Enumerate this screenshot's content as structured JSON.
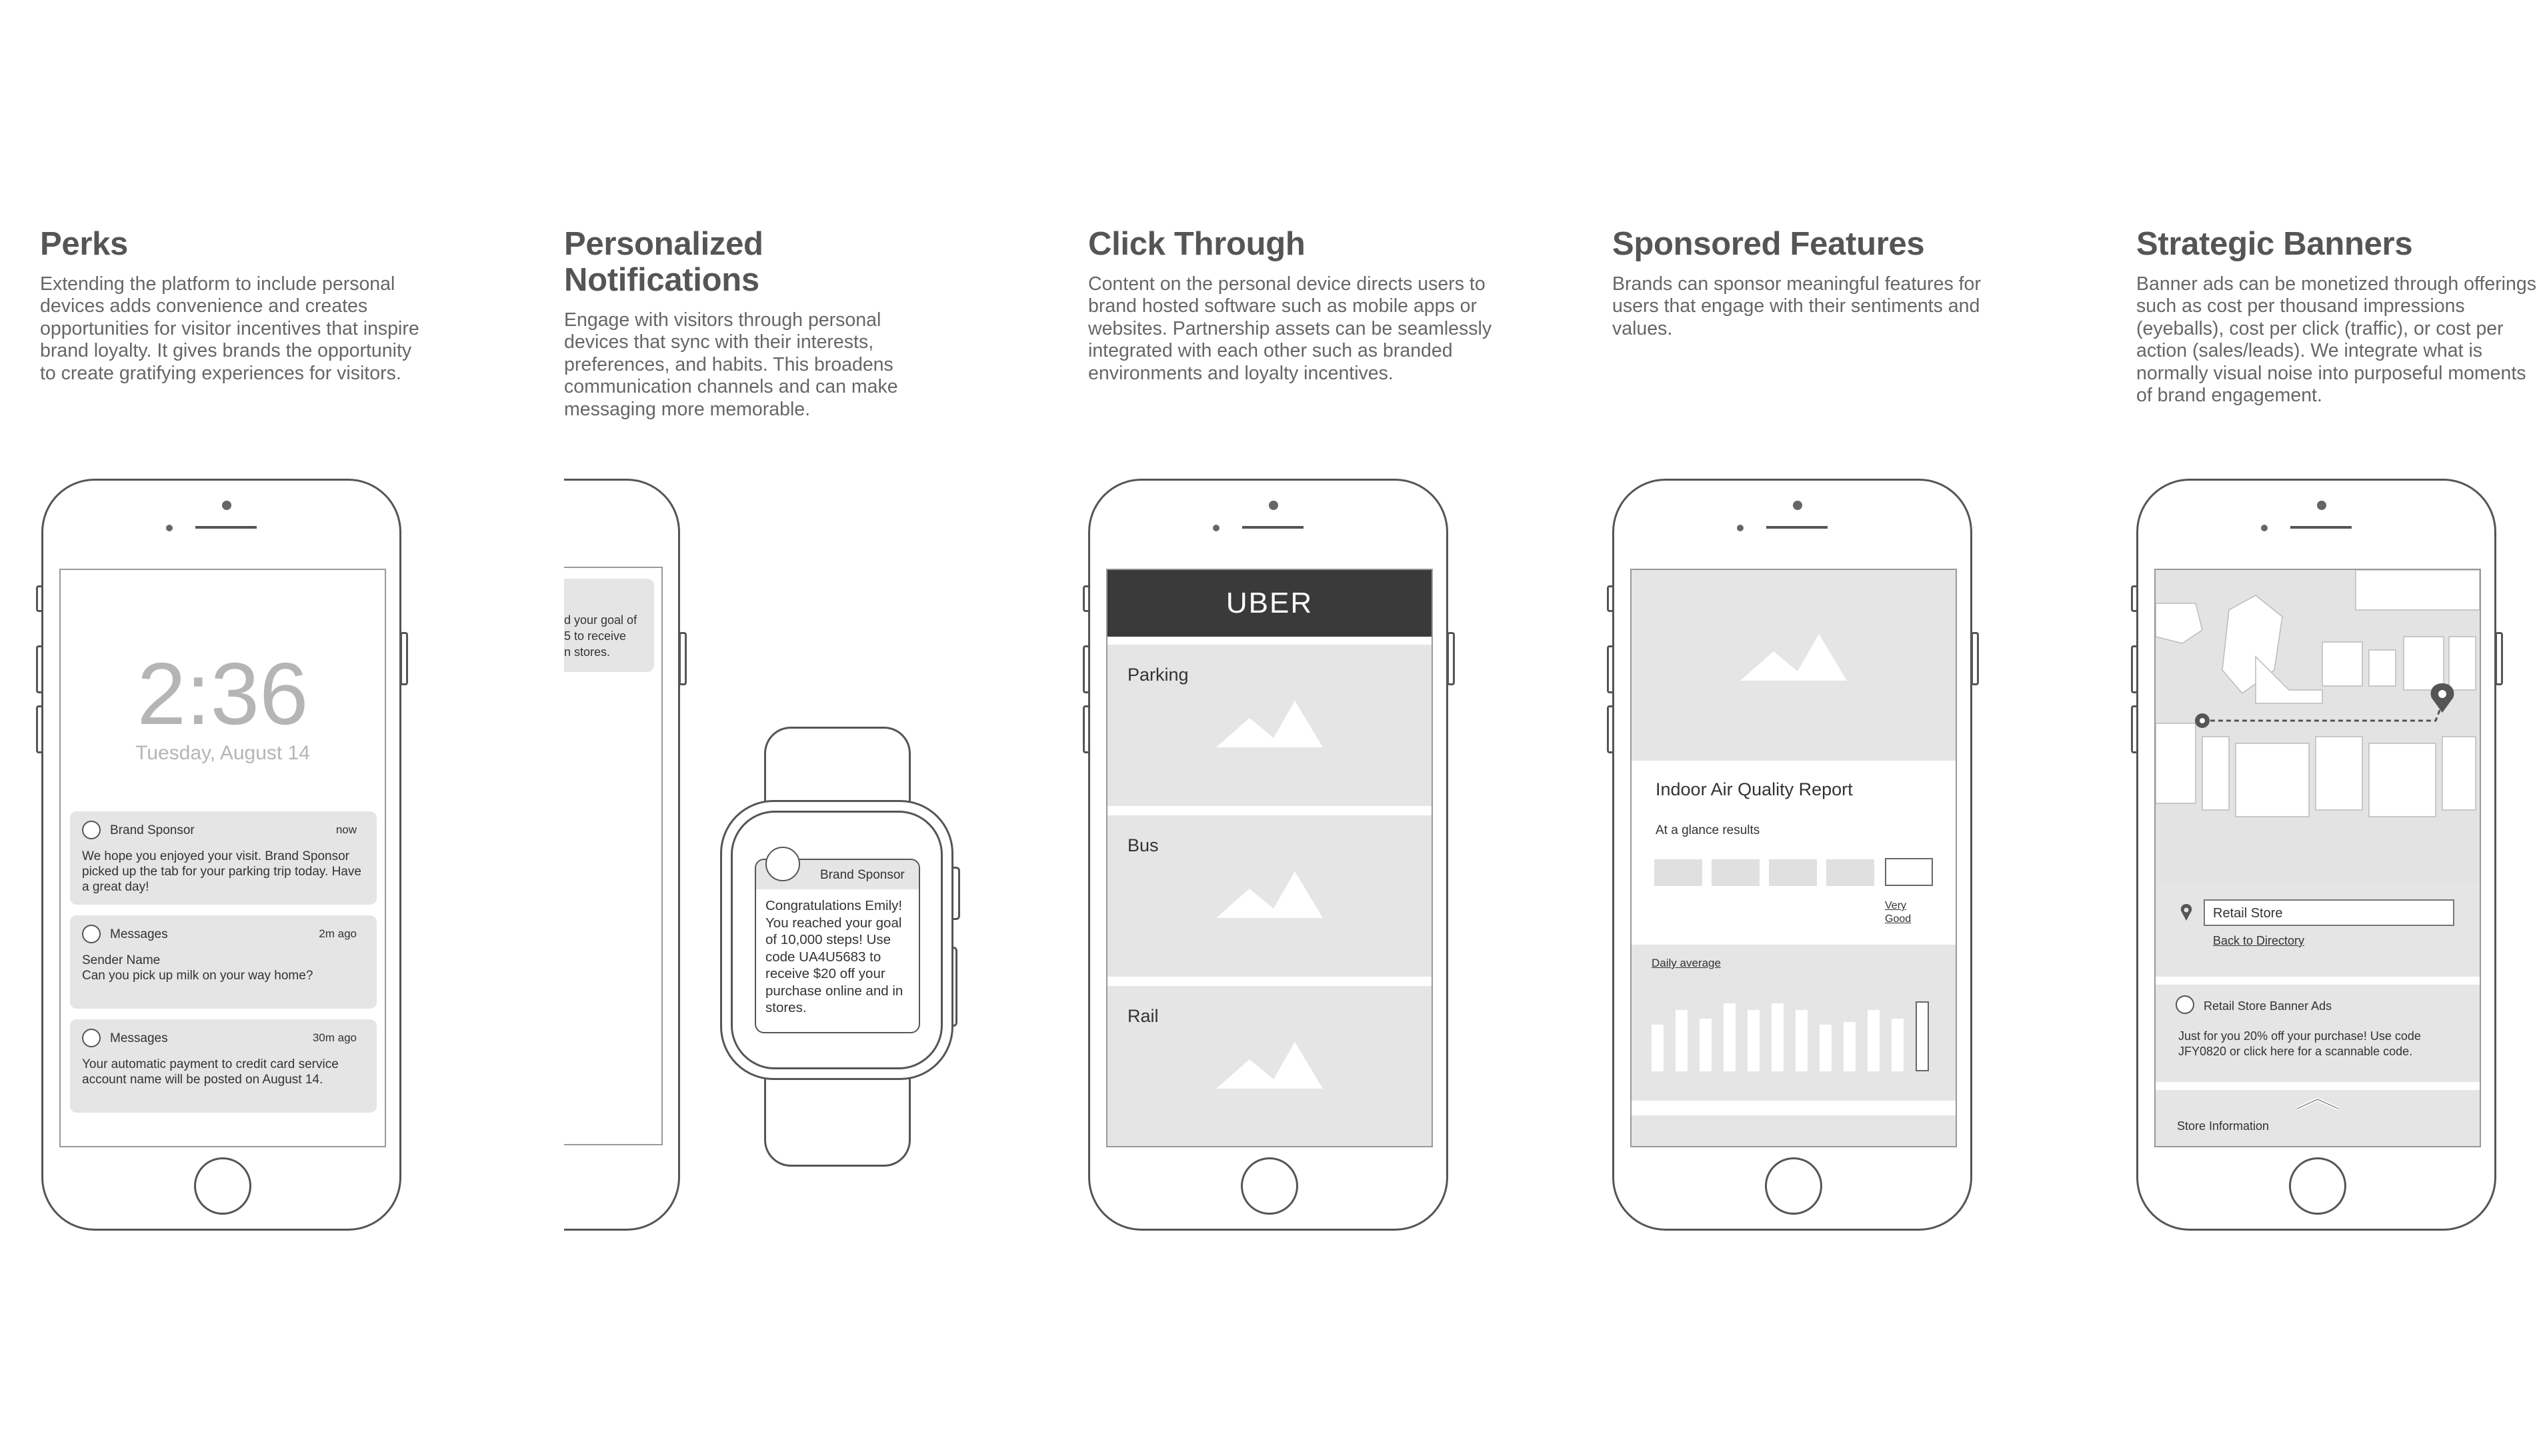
{
  "columns": [
    {
      "title": "Perks",
      "description": "Extending the platform to include personal devices adds convenience and creates opportunities for visitor incentives that inspire brand loyalty. It gives brands the opportunity to create gratifying experiences for visitors."
    },
    {
      "title": "Personalized Notifications",
      "description": "Engage with visitors through personal devices that sync with their interests, preferences, and habits. This broadens communication channels and can make messaging more memorable."
    },
    {
      "title": "Click Through",
      "description": "Content on the personal device directs users to brand hosted software such as mobile apps or websites. Partnership assets can be seamlessly integrated with each other such as branded environments and loyalty incentives."
    },
    {
      "title": "Sponsored Features",
      "description": "Brands can sponsor meaningful features for users that engage with their sentiments and values."
    },
    {
      "title": "Strategic Banners",
      "description": "Banner ads can be monetized through offerings such as cost per thousand impressions (eyeballs), cost per click (traffic), or cost per action (sales/leads). We integrate what is normally visual noise into purposeful moments of brand engagement."
    }
  ],
  "lockscreen": {
    "time": "2:36",
    "date": "Tuesday, August 14",
    "notifications": [
      {
        "app": "Brand Sponsor",
        "time": "now",
        "body": "We hope you enjoyed your visit. Brand Sponsor picked up the tab for your parking trip today. Have a great day!"
      },
      {
        "app": "Messages",
        "time": "2m ago",
        "body_line1": "Sender Name",
        "body_line2": "Can you pick up milk on your way home?"
      },
      {
        "app": "Messages",
        "time": "30m ago",
        "body": "Your automatic payment to credit card service account name will be posted on August 14."
      }
    ]
  },
  "partial_phone": {
    "lines": [
      "d your goal of",
      "5 to receive",
      "n stores."
    ]
  },
  "watch": {
    "app": "Brand Sponsor",
    "message": "Congratulations Emily! You reached your goal of 10,000 steps! Use code UA4U5683 to receive $20 off your purchase online and in stores."
  },
  "uber": {
    "header": "UBER",
    "options": [
      "Parking",
      "Bus",
      "Rail"
    ]
  },
  "air_quality": {
    "title": "Indoor Air Quality Report",
    "glance_label": "At a glance results",
    "rating_line1": "Very",
    "rating_line2": "Good",
    "daily_label": "Daily average",
    "daily_values": [
      0.55,
      0.72,
      0.62,
      0.8,
      0.72,
      0.8,
      0.72,
      0.55,
      0.58,
      0.72,
      0.62,
      0.82
    ]
  },
  "map_app": {
    "search_value": "Retail Store",
    "back_link": "Back to Directory",
    "ad_title": "Retail Store Banner Ads",
    "ad_body": "Just for you 20% off your purchase! Use code JFY0820 or click here for a scannable code.",
    "footer": "Store Information"
  }
}
